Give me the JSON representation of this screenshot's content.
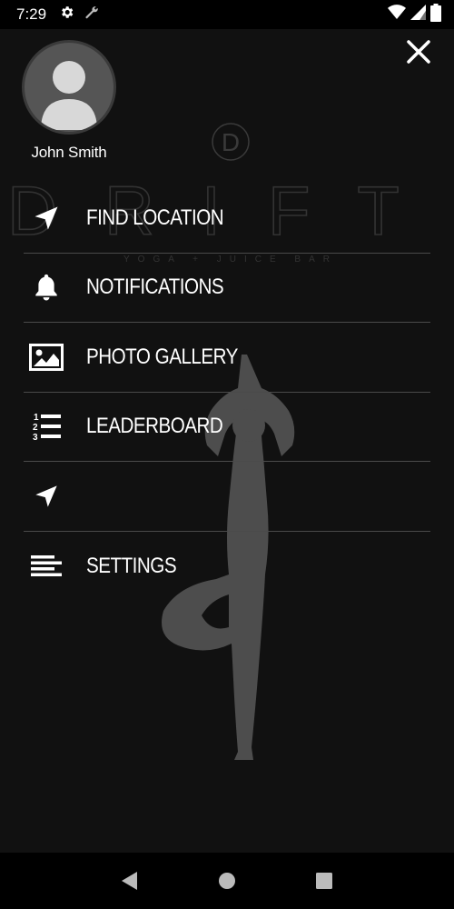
{
  "status": {
    "time": "7:29",
    "icons": [
      "gear-icon",
      "wrench-icon",
      "wifi-icon",
      "signal-icon",
      "battery-icon"
    ]
  },
  "background": {
    "logo_text": "DRIFT",
    "logo_mark": "D",
    "tagline": "YOGA + JUICE BAR"
  },
  "profile": {
    "name": "John Smith"
  },
  "menu": {
    "items": [
      {
        "label": "FIND LOCATION",
        "icon": "navigation-arrow-icon"
      },
      {
        "label": "NOTIFICATIONS",
        "icon": "bell-icon"
      },
      {
        "label": "PHOTO GALLERY",
        "icon": "image-icon"
      },
      {
        "label": "LEADERBOARD",
        "icon": "numbered-list-icon"
      },
      {
        "label": "",
        "icon": "navigation-arrow-icon"
      },
      {
        "label": "SETTINGS",
        "icon": "align-left-icon"
      }
    ]
  },
  "nav": {
    "buttons": [
      "back-icon",
      "home-icon",
      "recents-icon"
    ]
  },
  "colors": {
    "background": "#111111",
    "divider": "#4a4a4a",
    "text": "#ffffff",
    "silhouette": "#4d4d4d"
  }
}
